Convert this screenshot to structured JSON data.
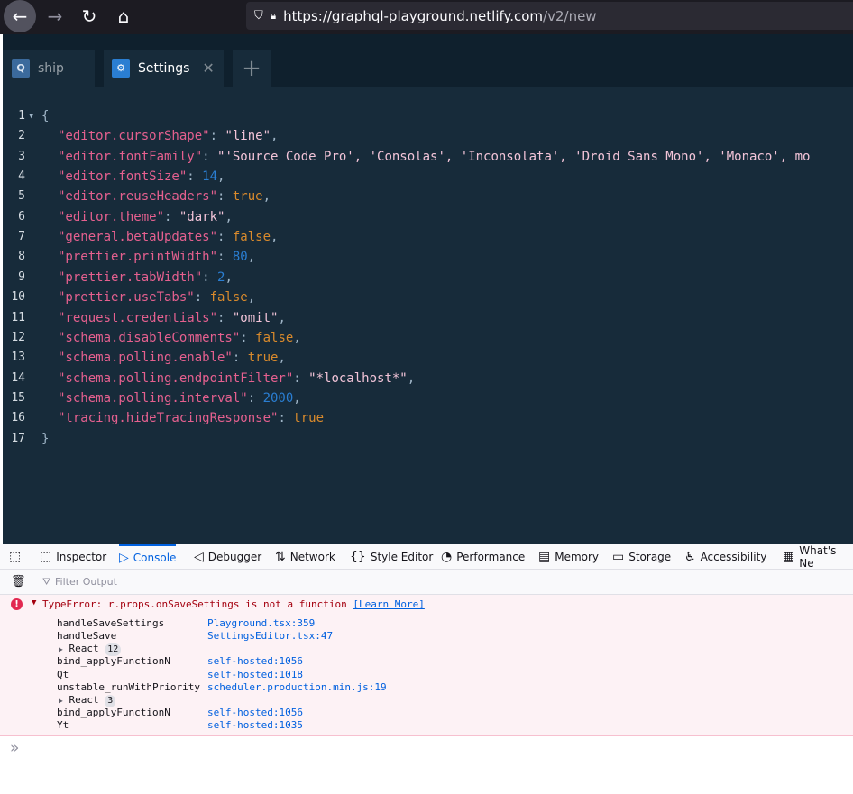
{
  "browser": {
    "url_host": "https://graphql-playground.netlify.com",
    "url_path": "/v2/new"
  },
  "tabs": [
    {
      "icon": "Q",
      "label": "ship"
    },
    {
      "icon": "⚙",
      "label": "Settings",
      "close": "✕"
    },
    {
      "label": "+"
    }
  ],
  "editor": {
    "lines": [
      {
        "n": "1",
        "open": "{"
      },
      {
        "n": "2",
        "key": "\"editor.cursorShape\"",
        "val": "\"line\"",
        "type": "s",
        "comma": ","
      },
      {
        "n": "3",
        "key": "\"editor.fontFamily\"",
        "val": "\"'Source Code Pro', 'Consolas', 'Inconsolata', 'Droid Sans Mono', 'Monaco', mo",
        "type": "s",
        "comma": ""
      },
      {
        "n": "4",
        "key": "\"editor.fontSize\"",
        "val": "14",
        "type": "n",
        "comma": ","
      },
      {
        "n": "5",
        "key": "\"editor.reuseHeaders\"",
        "val": "true",
        "type": "b",
        "comma": ","
      },
      {
        "n": "6",
        "key": "\"editor.theme\"",
        "val": "\"dark\"",
        "type": "s",
        "comma": ","
      },
      {
        "n": "7",
        "key": "\"general.betaUpdates\"",
        "val": "false",
        "type": "b",
        "comma": ","
      },
      {
        "n": "8",
        "key": "\"prettier.printWidth\"",
        "val": "80",
        "type": "n",
        "comma": ","
      },
      {
        "n": "9",
        "key": "\"prettier.tabWidth\"",
        "val": "2",
        "type": "n",
        "comma": ","
      },
      {
        "n": "10",
        "key": "\"prettier.useTabs\"",
        "val": "false",
        "type": "b",
        "comma": ","
      },
      {
        "n": "11",
        "key": "\"request.credentials\"",
        "val": "\"omit\"",
        "type": "s",
        "comma": ","
      },
      {
        "n": "12",
        "key": "\"schema.disableComments\"",
        "val": "false",
        "type": "b",
        "comma": ","
      },
      {
        "n": "13",
        "key": "\"schema.polling.enable\"",
        "val": "true",
        "type": "b",
        "comma": ","
      },
      {
        "n": "14",
        "key": "\"schema.polling.endpointFilter\"",
        "val": "\"*localhost*\"",
        "type": "s",
        "comma": ","
      },
      {
        "n": "15",
        "key": "\"schema.polling.interval\"",
        "val": "2000",
        "type": "n",
        "comma": ","
      },
      {
        "n": "16",
        "key": "\"tracing.hideTracingResponse\"",
        "val": "true",
        "type": "b",
        "comma": ""
      },
      {
        "n": "17",
        "open": "}"
      }
    ]
  },
  "devtools": {
    "tabs": [
      {
        "icon": "⬚",
        "label": "Inspector"
      },
      {
        "icon": "▷",
        "label": "Console"
      },
      {
        "icon": "◁",
        "label": "Debugger"
      },
      {
        "icon": "⇅",
        "label": "Network"
      },
      {
        "icon": "{}",
        "label": "Style Editor"
      },
      {
        "icon": "◔",
        "label": "Performance"
      },
      {
        "icon": "▤",
        "label": "Memory"
      },
      {
        "icon": "▭",
        "label": "Storage"
      },
      {
        "icon": "♿",
        "label": "Accessibility"
      },
      {
        "icon": "▦",
        "label": "What's Ne"
      }
    ],
    "filter_placeholder": "Filter Output",
    "error": {
      "title": "TypeError: r.props.onSaveSettings is not a function",
      "learn_more": "[Learn More]",
      "stack": [
        {
          "fn": "handleSaveSettings",
          "loc": "Playground.tsx:359"
        },
        {
          "fn": "handleSave",
          "loc": "SettingsEditor.tsx:47"
        },
        {
          "group": "React",
          "count": "12"
        },
        {
          "fn": "bind_applyFunctionN",
          "loc": "self-hosted:1056"
        },
        {
          "fn": "Qt",
          "loc": "self-hosted:1018"
        },
        {
          "fn": "unstable_runWithPriority",
          "loc": "scheduler.production.min.js:19"
        },
        {
          "group": "React",
          "count": "3"
        },
        {
          "fn": "bind_applyFunctionN",
          "loc": "self-hosted:1056"
        },
        {
          "fn": "Yt",
          "loc": "self-hosted:1035"
        }
      ]
    },
    "prompt": "»"
  }
}
